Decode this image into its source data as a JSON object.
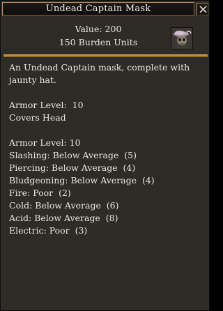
{
  "window": {
    "title": "Undead Captain Mask"
  },
  "item": {
    "value_text": "Value: 200",
    "burden_text": "150 Burden Units",
    "icon_name": "undead-captain-mask-icon"
  },
  "description": {
    "intro_lines": [
      "An Undead Captain mask, complete with",
      "jaunty hat."
    ],
    "armor_level_line": "Armor Level:  10",
    "covers_line": "Covers Head",
    "protection_header": "Armor Level: 10",
    "protections": [
      "Slashing: Below Average  (5)",
      "Piercing: Below Average  (4)",
      "Bludgeoning: Below Average  (4)",
      "Fire: Poor  (2)",
      "Cold: Below Average  (6)",
      "Acid: Below Average  (8)",
      "Electric: Poor  (3)"
    ]
  },
  "colors": {
    "panel_bg": "#2e2a26",
    "text": "#e9e6df",
    "divider_gold": "#d9a64a",
    "title_border": "#b8935a"
  }
}
